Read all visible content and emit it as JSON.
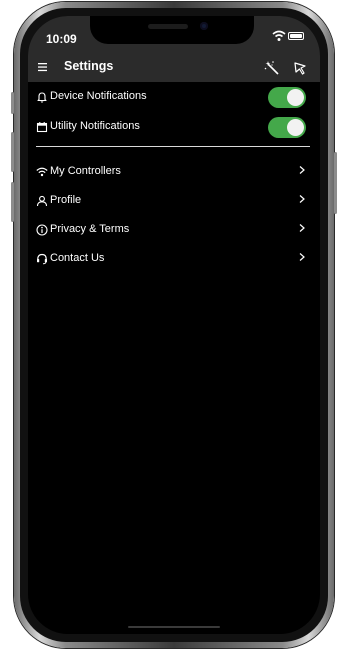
{
  "status_bar": {
    "time": "10:09"
  },
  "header": {
    "title": "Settings",
    "menu_icon": "hamburger-menu-icon",
    "action_icons": [
      "magic-wand-icon",
      "pointer-icon"
    ]
  },
  "toggles": [
    {
      "label": "Device Notifications",
      "icon": "bell-icon",
      "enabled": true
    },
    {
      "label": "Utility Notifications",
      "icon": "calendar-icon",
      "enabled": true
    }
  ],
  "nav_items": [
    {
      "label": "My Controllers",
      "icon": "wifi-icon"
    },
    {
      "label": "Profile",
      "icon": "person-icon"
    },
    {
      "label": "Privacy & Terms",
      "icon": "info-circle-icon"
    },
    {
      "label": "Contact Us",
      "icon": "headset-icon"
    }
  ],
  "colors": {
    "toggle_on": "#44a84a",
    "header_bg": "#2b2b2b",
    "screen_bg": "#000000"
  }
}
